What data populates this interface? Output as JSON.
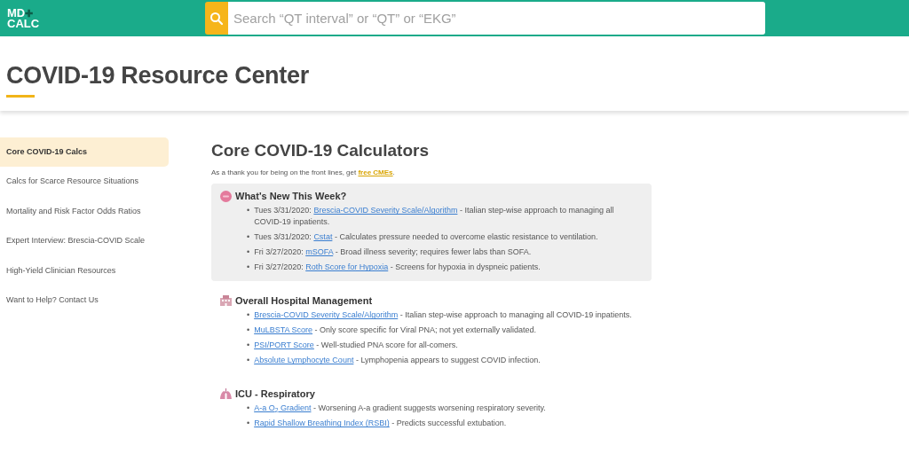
{
  "logo": {
    "line_1": "MD",
    "plus": "✚",
    "line_2": "CALC"
  },
  "bullet": "•",
  "search": {
    "placeholder": "Search “QT interval” or “QT” or “EKG”"
  },
  "page_title": "COVID-19 Resource Center",
  "sidebar": {
    "items": [
      {
        "label": "Core COVID-19 Calcs",
        "selected": true
      },
      {
        "label": "Calcs for Scarce Resource Situations",
        "selected": false
      },
      {
        "label": "Mortality and Risk Factor Odds Ratios",
        "selected": false
      },
      {
        "label": "Expert Interview: Brescia-COVID Scale",
        "selected": false
      },
      {
        "label": "High-Yield Clinician Resources",
        "selected": false
      },
      {
        "label": "Want to Help? Contact Us",
        "selected": false
      }
    ]
  },
  "main": {
    "heading": "Core COVID-19 Calculators",
    "intro": "As a thank you for being on the front lines, get ",
    "intro_link": "free CMEs",
    "intro_end": ".",
    "sections": [
      {
        "kind": "news",
        "title": "What's New This Week?",
        "items": [
          {
            "prefix": "Tues 3/31/2020: ",
            "link": "Brescia-COVID Severity Scale/Algorithm",
            "text": " - Italian step-wise approach to managing all COVID-19 inpatients."
          },
          {
            "prefix": "Tues 3/31/2020: ",
            "link": "Cstat",
            "text": " - Calculates pressure needed to overcome elastic resistance to ventilation."
          },
          {
            "prefix": "Fri 3/27/2020: ",
            "link": "mSOFA",
            "text": " - Broad illness severity; requires fewer labs than SOFA."
          },
          {
            "prefix": "Fri 3/27/2020: ",
            "link": "Roth Score for Hypoxia",
            "text": " - Screens for hypoxia in dyspneic patients."
          }
        ]
      },
      {
        "kind": "hospital",
        "title": "Overall Hospital Management",
        "items": [
          {
            "link": "Brescia-COVID Severity Scale/Algorithm",
            "text": " - Italian step-wise approach to managing all COVID-19 inpatients."
          },
          {
            "link": "MuLBSTA Score",
            "text": " - Only score specific for Viral PNA; not yet externally validated."
          },
          {
            "link": "PSI/PORT Score",
            "text": " - Well-studied PNA score for all-comers."
          },
          {
            "link": "Absolute Lymphocyte Count",
            "text": " - Lymphopenia appears to suggest COVID infection."
          }
        ]
      },
      {
        "kind": "lungs",
        "title": "ICU - Respiratory",
        "items": [
          {
            "link": "A-a O$_{2}$ Gradient",
            "text": " - Worsening A-a gradient suggests worsening respiratory severity."
          },
          {
            "link": "Rapid Shallow Breathing Index (RSBI)",
            "text": " - Predicts successful extubation."
          }
        ]
      }
    ]
  }
}
